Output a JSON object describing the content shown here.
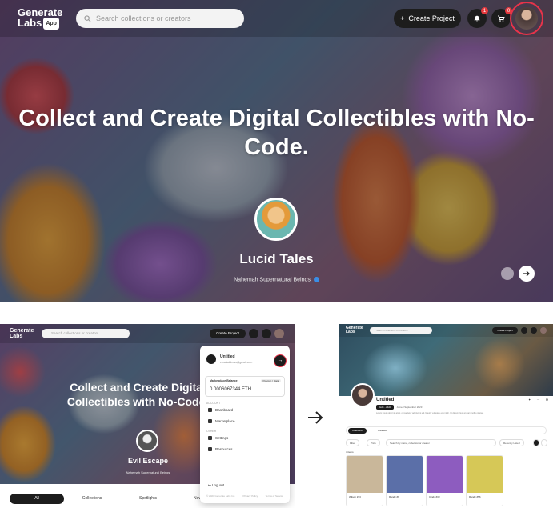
{
  "hero": {
    "brand": {
      "line1": "Generate",
      "line2": "Labs",
      "tag": "App"
    },
    "search_placeholder": "Search collections or creators",
    "create_label": "Create Project",
    "notification_count": "1",
    "cart_count": "0",
    "headline": "Collect and Create Digital Collectibles with No-Code.",
    "collection_name": "Lucid Tales",
    "creator_name": "Nahemah Supernatural Beings"
  },
  "left_shot": {
    "brand": {
      "line1": "Generate",
      "line2": "Labs",
      "tag": "App"
    },
    "search_placeholder": "Search collections or creators",
    "create_label": "Create Project",
    "headline": "Collect and Create Digital Collectibles with No-Code.",
    "collection_name": "Evil Escape",
    "creator_name": "Nahemah Supernatural Beings",
    "tabs": [
      "All",
      "Collections",
      "Spotlights",
      "New"
    ],
    "menu": {
      "user_name": "Untitled",
      "user_email": "emailaddress@gmail.com",
      "balance_label": "Marketplace Balance",
      "network": "Polygon / Matic",
      "balance_value": "0.0006067344 ETH",
      "section_account": "ACCOUNT",
      "dashboard": "Dashboard",
      "marketplace": "Marketplace",
      "section_other": "OTHER",
      "settings": "Settings",
      "resources": "Resources",
      "logout": "Log out",
      "footer_copy": "© 2023 Generate Labs Inc.",
      "footer_privacy": "Privacy Policy",
      "footer_terms": "Terms of Service"
    }
  },
  "right_shot": {
    "brand": {
      "line1": "Generate",
      "line2": "Labs",
      "tag": "App"
    },
    "search_placeholder": "Search collections or creators",
    "create_label": "Create Project",
    "profile_name": "Untitled",
    "wallet_pill": "0xdc...d4d4",
    "joined": "Joined September 2023",
    "description": "Lorem ipsum dolor sit amet, consectetur adipiscing elit. Mauris vulputate eget nibh. Ut dictum risus at diam mollis congue.",
    "tabs": [
      "Collected",
      "Created"
    ],
    "filters": {
      "filter": "Filter",
      "price": "Price",
      "search": "Search by name, collection or creator",
      "sort": "Recently Listed"
    },
    "item_count": "4 items",
    "cards": [
      "Wilson #13",
      "Randy #9",
      "Cindy #33",
      "Randy #56"
    ],
    "card_colors": [
      "#c9b79a",
      "#5b6fa8",
      "#8d5cbf",
      "#d6c857"
    ]
  },
  "colors": {
    "accent_ring": "#e8334a",
    "dark": "#1d1d1d",
    "verified": "#3a8ee6"
  }
}
